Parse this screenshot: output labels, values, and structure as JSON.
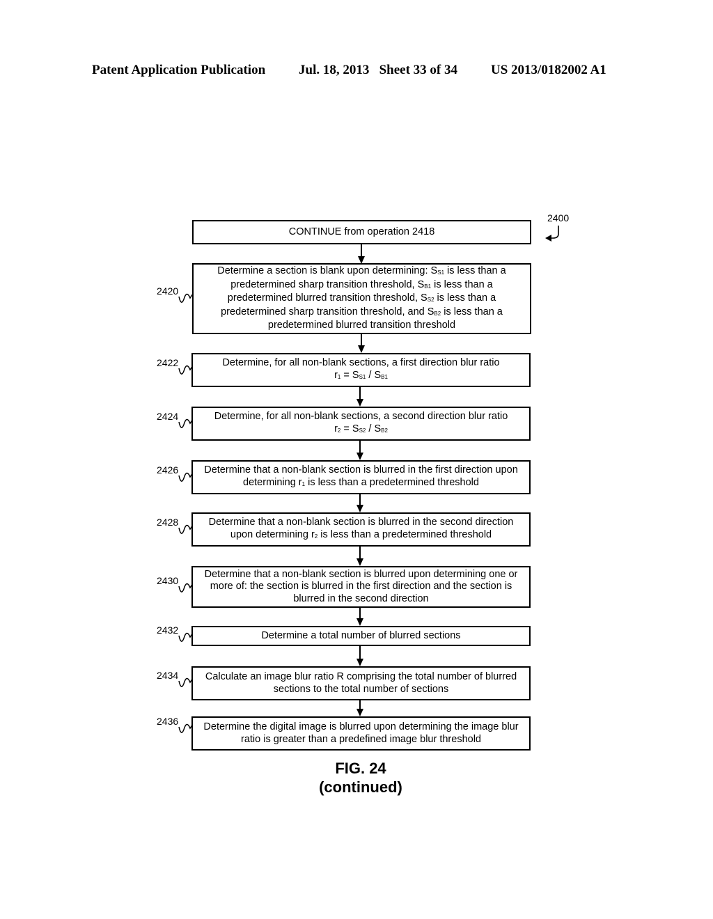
{
  "header": {
    "left": "Patent Application Publication",
    "date_sheet": "Jul. 18, 2013   Sheet 33 of 34",
    "pub_number": "US 2013/0182002 A1"
  },
  "figure": {
    "ref": "2400",
    "title": "FIG. 24",
    "subtitle": "(continued)"
  },
  "steps": [
    {
      "ref": "",
      "text": "CONTINUE from operation 2418"
    },
    {
      "ref": "2420",
      "parts": [
        "Determine a section is blank upon determining: S",
        "S1",
        " is less than a predetermined sharp transition threshold, S",
        "B1",
        " is less than a predetermined blurred transition threshold, S",
        "S2",
        " is less than a predetermined sharp transition threshold, and S",
        "B2",
        " is less than a predetermined blurred transition threshold"
      ]
    },
    {
      "ref": "2422",
      "line1": "Determine, for all non-blank sections, a first direction blur ratio",
      "formula": [
        "r",
        "1",
        " = S",
        "S1",
        " / S",
        "B1"
      ]
    },
    {
      "ref": "2424",
      "line1": "Determine, for all non-blank sections, a second direction blur ratio",
      "formula": [
        "r",
        "2",
        " = S",
        "S2",
        " / S",
        "B2"
      ]
    },
    {
      "ref": "2426",
      "parts": [
        "Determine that a non-blank section is blurred in the first direction upon determining r",
        "1",
        " is less than a predetermined threshold"
      ]
    },
    {
      "ref": "2428",
      "parts": [
        "Determine that a non-blank section is blurred in the second direction upon determining r",
        "2",
        " is less than a predetermined threshold"
      ]
    },
    {
      "ref": "2430",
      "text": "Determine that a non-blank section is blurred upon determining one or more of: the section is blurred in the first direction and the section is blurred in the second direction"
    },
    {
      "ref": "2432",
      "text": "Determine a total number of blurred sections"
    },
    {
      "ref": "2434",
      "text": "Calculate an image blur ratio R comprising the total number of blurred sections to the total number of sections"
    },
    {
      "ref": "2436",
      "text": "Determine the digital image is blurred upon determining the image blur ratio is greater than a predefined image blur threshold"
    }
  ]
}
